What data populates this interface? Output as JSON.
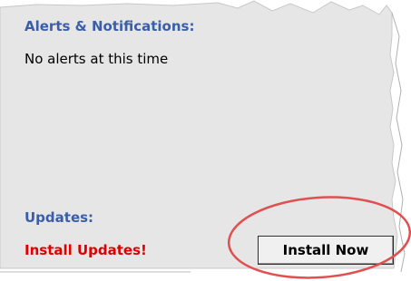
{
  "alerts": {
    "title": "Alerts & Notifications:",
    "message": "No alerts at this time"
  },
  "updates": {
    "title": "Updates:",
    "install_link": "Install Updates!",
    "install_button": "Install Now"
  },
  "colors": {
    "panel_bg": "#e6e6e6",
    "title_blue": "#3a5ea8",
    "alert_red": "#e00000",
    "highlight_red": "#e05050"
  }
}
